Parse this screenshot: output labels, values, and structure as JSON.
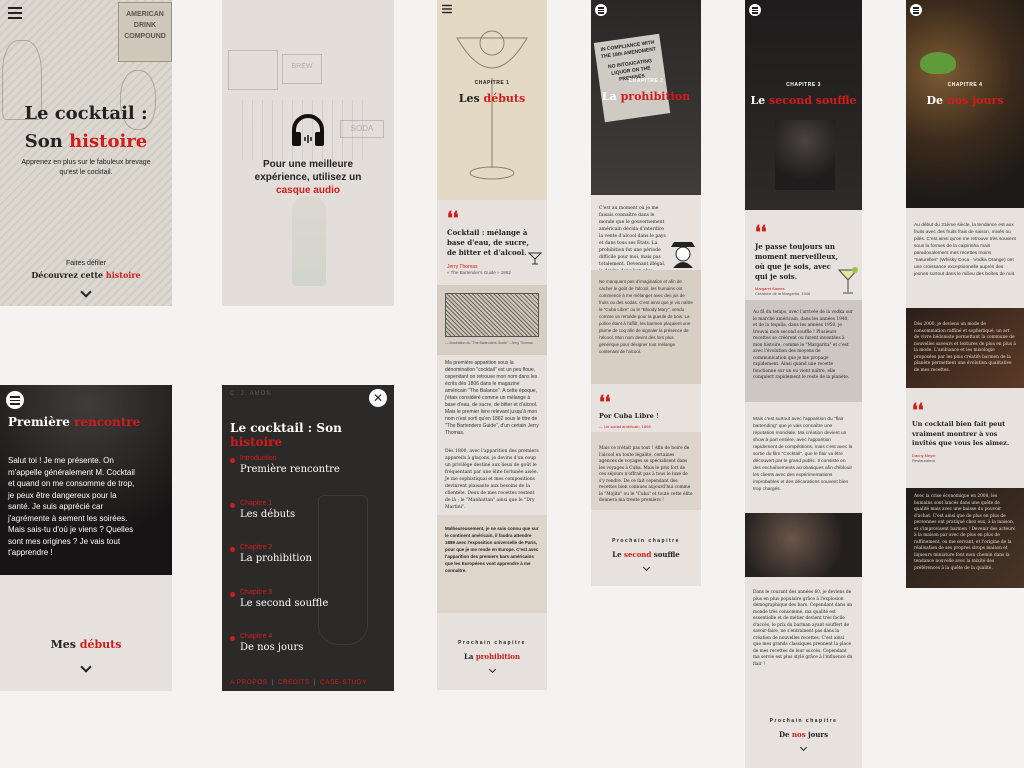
{
  "colors": {
    "accent": "#d11c1c",
    "dark": "#1f1d1d",
    "paper": "#e8e4df"
  },
  "p1": {
    "title_line1": "Le cocktail :",
    "title_line2_prefix": "Son ",
    "title_line2_accent": "histoire",
    "subtitle": "Apprenez en plus sur le fabuleux brevage qu'est le cocktail.",
    "cta_small": "Faites défiler",
    "cta_prefix": "Découvrez cette ",
    "cta_accent": "histoire",
    "bg_sign": "AMERICAN DRINK COMPOUND"
  },
  "p2": {
    "icon": "headphones-icon",
    "text_line1": "Pour une meilleure",
    "text_line2": "expérience, utilisez un",
    "text_accent": "casque audio",
    "sign_brew": "BREW",
    "sign_soda": "SODA"
  },
  "p3": {
    "chapter_label": "CHAPITRE 1",
    "title_prefix": "Les ",
    "title_accent": "débuts",
    "quote": "Cocktail : mélange à base d'eau, de sucre, de bitter et d'alcool.",
    "author": "Jerry Thomas",
    "source": "« The Bartender's Guide » 1862",
    "caption": "— Illustration du \"The Bartenders Guide\" - Jerry Thomas",
    "para1": "Ma première apparition sous la dénomination \"cocktail\" est un peu floue, cependant on retrouve mon nom dans les écrits dès 1806 dans le magazine américain \"The Balance\". A cette époque, j'étais considéré comme un mélange à base d'eau, de sucre, de bitter et d'alcool. Mais le premier livre relevant jusqu'à mon nom n'est sorti qu'en 1862 sous le titre de \"The Bartenders Guide\", d'un certain Jerry Thomas.",
    "para2": "Dès 1800, avec l'apparition des premiers appareils à glaçons, je devins d'un coup un privilège destiné aux lieux de goût le fréquentant par une élite fortunée aisée. Je me sophistiquai et mes compositions devinrent plaisante aux besoins de la clientèle. Deux de mes recettes restent de là ; le \"Manhattan\" ainsi que le \"Dry Martini\".",
    "highlight": "Malheureusement, je ne suis connu que sur le continent américain, il faudra attendre 1889 avec l'exposition universelle de Paris, pour que je me rende en Europe. C'est avec l'apparition des premiers bars américains que les Européens vont apprendre à me connaître.",
    "next_label": "Prochain chapitre",
    "next_prefix": "La ",
    "next_accent": "prohibition"
  },
  "p4": {
    "chapter_label": "CHAPITRE 2",
    "title_prefix": "La ",
    "title_accent": "prohibition",
    "protest_sign1": "IN COMPLIANCE WITH THE 18th AMENDMENT",
    "protest_sign2": "NO INTOXICATING LIQUOR ON THE PREMISES",
    "para1": "C'est au moment où je me faisais connaître dans le monde que le gouvernement américain décida d'interdire la vente d'alcool dans le pays et dans tous ses États. La prohibition fut une période difficile pour moi, mais pas totalement. Devenant illégal, je devins donc bon plus populaire auprès de la pègre et de la bourgeoisie.",
    "para2": "Ne manquant pas d'imagination et afin de cacher le goût de l'alcool, les humains ont commencé à me mélanger avec des jus de fruits ou des sodas. C'est ainsi que je vis naître le \"Cuba Libre\" ou le \"Bloody Mary\", vendu comme un remède pour la gueule de bois. La police étant à l'affût, les barmen plaçaient une plume de coq afin de signaler la présence de l'alcool. Mon nom devint dès lors plus générique pour désigner tout mélange contenant de l'alcool.",
    "quote": "Por Cuba Libre !",
    "quote_author": "— Un soldat américain, 1898",
    "para3": "Mais ce n'était pas tout ! Afin de boire de l'alcool en toute légalité, certaines agences de voyages se spécialisent dans les voyages à Cuba. Mais le prix fort de ces séjours n'offrait pas à tous le luxe de s'y rendre. De ce fait cependant des recettes bien connues aujourd'hui comme le \"Mojito\" ou le \"Cuba\" et toute cette élite donnera ma trente premiers !",
    "next_label": "Prochain chapitre",
    "next_prefix": "Le ",
    "next_accent": "second",
    "next_suffix": " souffle"
  },
  "p5": {
    "chapter_label": "CHAPITRE 3",
    "title_prefix": "Le ",
    "title_accent": "second souffle",
    "quote": "Je passe toujours un moment merveilleux, où que je sois, avec qui je sois.",
    "author": "Margaret Sames",
    "role": "Créatrice de la Margarita, 1948",
    "para1": "Au fil du temps, avec l'arrivée de la vodka sur le marché américain, dans les années 1940, et de la tequila, dans les années 1950, je trouvai mon second souffle ! Plusieurs recettes se créèrent ou furent inventées à mon histoire, comme le \"Margarita\" et c'est avec l'évolution des moyens de communication que je me propage rapidement. Ainsi quand une recette fonctionne sur un ou vient naître, elle conquiert rapidement le reste de la planète.",
    "para2": "Mais c'est surtout avec l'apparition du \"flair bartending\" que je vais connaître une réputation mondiale. Ma création devient un show à part entière, avec l'apparition rapidement de compétitions, mais c'est avec la sortie du film \"Cocktail\", que le flair va être découvert par le grand public. Il consiste en des enchaînements acrobatiques afin d'éblouir les clients avec des expérimentations improbables et des décorations souvent bien trop chargés.",
    "para3": "Dans le courant des années 60, je deviens de plus en plus populaire grâce à l'explosion démographique des bars. Cependant dans un monde très consommé, ma qualité est essentielle et de métier devient très facile d'accès, le prix du barman ayant souffert de savoir-faire, ne s'entrainent pas dans la création de nouvelles recettes. C'est ainsi que mes grands classiques prennent la place de mes recettes de leur succès. Cependant ma servie est plus stylé grâce à l'influence du flair !",
    "next_label": "Prochain chapitre",
    "next_prefix": "De ",
    "next_accent": "nos",
    "next_suffix": " jours"
  },
  "p6": {
    "chapter_label": "CHAPITRE 4",
    "title_prefix": "De ",
    "title_accent": "nos jours",
    "para1": "Au début du 21ème siècle, la tendance est aux fruits avec des fruits frais de saison, mixés ou pilés. C'est ainsi qu'on me retrouve très souvent sous la formes de la caipirinha mais paradoxalement mes recettes moins \"naturelles\" (Whisky Coca - Vodka Orange) ont une croissance exceptionnelle auprès des jeunes surtout dans le milieu des boîtes de nuit.",
    "para2": "Dès 2000, je deviens un mode de consommation raffiné et sophistiqué, un art de vivre hédoniste permettant la commune de nouvelles saveurs et textures de plus en plus à la mode. L'ambiance et les mixologie proposées par les plus créatifs barmen de la planète permettent une évolution qualitative de mes recettes.",
    "quote": "Un cocktail bien fait peut vraiment montrer à vos invités que vous les aimez.",
    "author": "Danny Meyer",
    "role": "Restaurateur",
    "para3": "Avec la crise économique en 2008, les humains sont lancés dans une quête de qualité mais avec une baisse du pouvoir d'achat. C'est ainsi que de plus en plus de personnes ont pratiqué chez eux, à la maison, et s'improvisent barmen ! Devenir des acteurs à la maison par avec de plus en plus de raffinement, ou me servant, et l'origine de la réalisation de ses propres sirops maison et liqueurs miniature font mon chemin dans la tendance nouvelle avec la mixité des préférences à la quête de la qualité."
  },
  "p7": {
    "title_prefix": "Première ",
    "title_accent": "rencontre",
    "body": "Salut toi ! Je me présente. On m'appelle généralement M. Cocktail et quand on me consomme de trop, je peux être dangereux pour la santé. Je suis apprécié car j'agrémente à sement les soirées. Mais sais-tu d'où je viens ? Quelles sont mes origines ? Je vais tout t'apprendre !",
    "next_prefix": "Mes ",
    "next_accent": "débuts"
  },
  "p8": {
    "title_prefix": "Le cocktail : ",
    "title_sep": "Son ",
    "title_accent": "histoire",
    "items": [
      {
        "label": "Introduction",
        "title": "Première rencontre"
      },
      {
        "label": "Chapitre 1",
        "title": "Les débuts"
      },
      {
        "label": "Chapitre 2",
        "title": "La prohibition"
      },
      {
        "label": "Chapitre 3",
        "title": "Le second souffle"
      },
      {
        "label": "Chapitre 4",
        "title": "De nos jours"
      }
    ],
    "footer": [
      "A PROPOS",
      "CREDITS",
      "CASE-STUDY"
    ],
    "bg_sign": "C. J. AMON"
  }
}
